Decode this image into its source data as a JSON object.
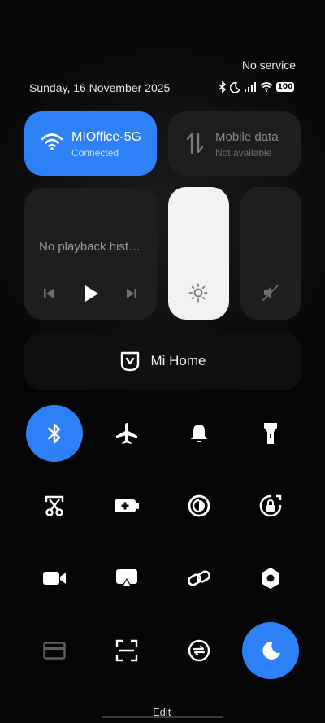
{
  "status_bar": {
    "carrier": "No service",
    "date": "Sunday, 16 November 2025",
    "battery": "100",
    "icons": [
      "bluetooth-icon",
      "moon-icon",
      "signal-icon",
      "wifi-icon",
      "battery-icon"
    ]
  },
  "tiles": {
    "wifi": {
      "name": "MIOffice-5G",
      "status": "Connected",
      "icon": "wifi-icon",
      "active": true
    },
    "mobile_data": {
      "name": "Mobile data",
      "status": "Not available",
      "icon": "mobile-data-icon",
      "active": false
    },
    "media": {
      "text": "No playback hist…",
      "controls": [
        "previous-icon",
        "play-icon",
        "next-icon"
      ]
    },
    "brightness": {
      "icon": "sun-icon"
    },
    "volume": {
      "icon": "mute-icon"
    }
  },
  "mi_home": {
    "label": "Mi Home",
    "icon": "mi-home-icon"
  },
  "toggles": [
    {
      "name": "bluetooth",
      "icon": "bluetooth-icon",
      "active": true
    },
    {
      "name": "airplane",
      "icon": "airplane-icon",
      "active": false
    },
    {
      "name": "sound",
      "icon": "bell-icon",
      "active": false
    },
    {
      "name": "flashlight",
      "icon": "flashlight-icon",
      "active": false
    },
    {
      "name": "screenshot",
      "icon": "scissors-icon",
      "active": false
    },
    {
      "name": "battery-saver",
      "icon": "battery-saver-icon",
      "active": false
    },
    {
      "name": "dark-mode",
      "icon": "dark-mode-icon",
      "active": false
    },
    {
      "name": "auto-rotate",
      "icon": "rotate-lock-icon",
      "active": false
    },
    {
      "name": "screen-record",
      "icon": "video-icon",
      "active": false
    },
    {
      "name": "cast",
      "icon": "cast-icon",
      "active": false
    },
    {
      "name": "link",
      "icon": "link-icon",
      "active": false
    },
    {
      "name": "settings",
      "icon": "hexagon-icon",
      "active": false
    },
    {
      "name": "card",
      "icon": "card-icon",
      "active": false
    },
    {
      "name": "scanner",
      "icon": "scan-icon",
      "active": false
    },
    {
      "name": "sync",
      "icon": "sync-icon",
      "active": false
    },
    {
      "name": "night-mode",
      "icon": "moon-icon",
      "active": true
    }
  ],
  "footer": {
    "edit_label": "Edit"
  },
  "colors": {
    "accent": "#2e80f6",
    "tile": "#1e1e1e",
    "background": "#0d0d0d"
  }
}
